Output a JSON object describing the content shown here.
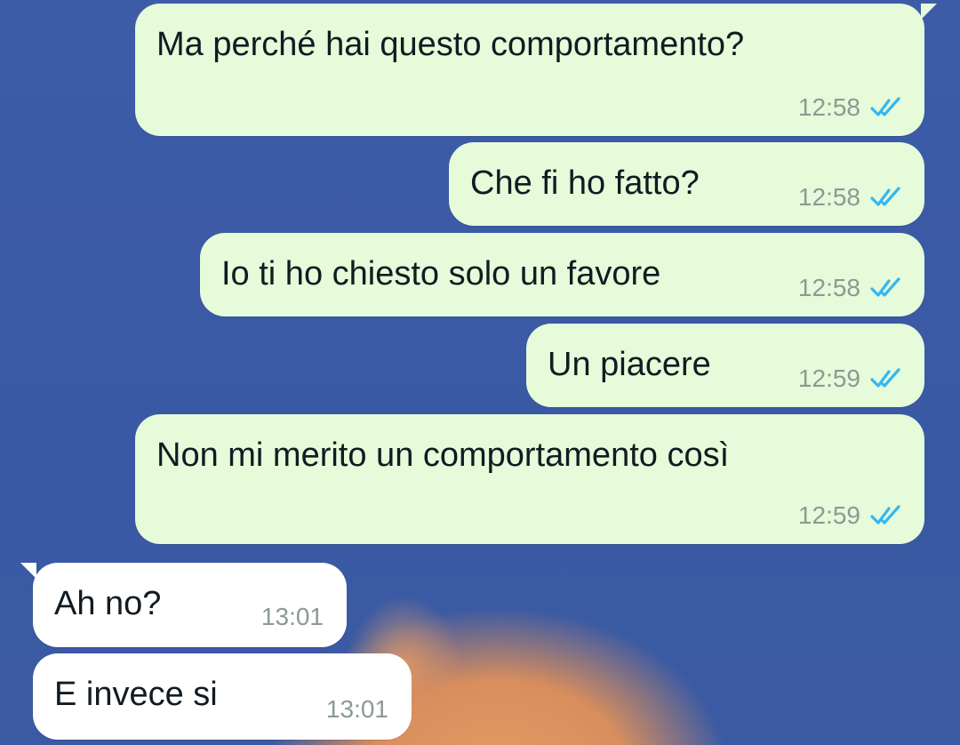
{
  "messages": [
    {
      "direction": "out",
      "text": "Ma perché hai questo comportamento?",
      "time": "12:58",
      "status": "read"
    },
    {
      "direction": "out",
      "text": "Che fi ho fatto?",
      "time": "12:58",
      "status": "read"
    },
    {
      "direction": "out",
      "text": "Io ti ho chiesto solo un favore",
      "time": "12:58",
      "status": "read"
    },
    {
      "direction": "out",
      "text": "Un piacere",
      "time": "12:59",
      "status": "read"
    },
    {
      "direction": "out",
      "text": "Non mi merito un comportamento così",
      "time": "12:59",
      "status": "read"
    },
    {
      "direction": "in",
      "text": "Ah no?",
      "time": "13:01"
    },
    {
      "direction": "in",
      "text": "E invece si",
      "time": "13:01"
    }
  ],
  "colors": {
    "outgoing_bubble": "#e5fbd9",
    "incoming_bubble": "#ffffff",
    "read_ticks": "#34b7f1",
    "wallpaper": "#3b5aa6"
  },
  "icons": {
    "read_status": "double-check-icon"
  }
}
